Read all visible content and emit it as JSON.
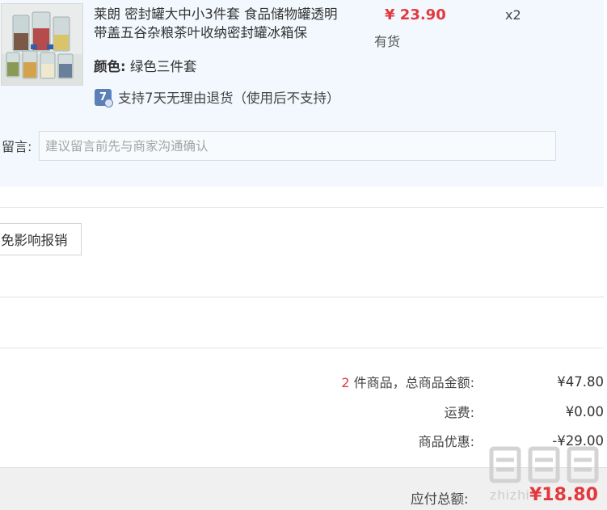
{
  "product": {
    "title": "莱朗 密封罐大中小3件套 食品储物罐透明带盖五谷杂粮茶叶收纳密封罐冰箱保",
    "price": "¥ 23.90",
    "stock": "有货",
    "quantity": "x2",
    "attr_label": "颜色:",
    "attr_value": "绿色三件套",
    "return_icon_text": "7",
    "return_policy": "支持7天无理由退货（使用后不支持）"
  },
  "message": {
    "label": "留言:",
    "placeholder": "建议留言前先与商家沟通确认"
  },
  "reimburse_button": "免影响报销",
  "summary": {
    "item_count": "2",
    "items_label": "件商品，总商品金额:",
    "items_total": "¥47.80",
    "shipping_label": "运费:",
    "shipping_value": "¥0.00",
    "discount_label": "商品优惠:",
    "discount_value": "-¥29.00"
  },
  "footer": {
    "payable_label": "应付总额:",
    "payable_total": "¥18.80"
  },
  "watermark": {
    "text": "zhizhi"
  },
  "colors": {
    "price_red": "#e2393e",
    "panel_bg": "#f2f8fd",
    "icon_blue": "#5b7fb7"
  }
}
